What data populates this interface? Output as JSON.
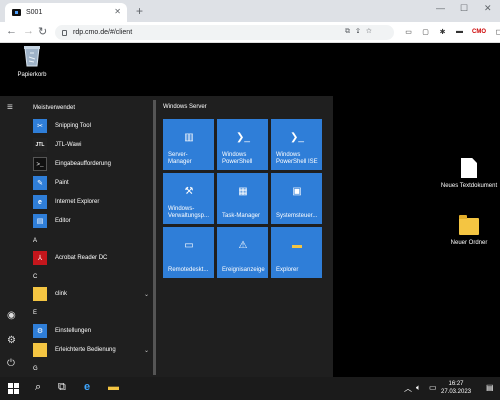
{
  "browser": {
    "tab_title": "S001",
    "tab_close": "✕",
    "new_tab": "+",
    "url": "rdp.cmo.de/#/client",
    "cmo_badge": "CMO",
    "back": "←",
    "forward": "→",
    "reload": "↻",
    "minimize": "—",
    "maximize": "☐",
    "close": "✕",
    "menu": "⋮"
  },
  "desktop": {
    "icons": [
      {
        "label": "Papierkorb",
        "icon": "recycle-bin-icon"
      },
      {
        "label": "Neues Textdokument",
        "icon": "text-document-icon"
      },
      {
        "label": "Neuer Ordner",
        "icon": "folder-icon"
      }
    ]
  },
  "start_menu": {
    "list_header": "Meistverwendet",
    "most_used": [
      {
        "label": "Snipping Tool",
        "icon": "snipping-tool-icon",
        "color": "#2f7ed8"
      },
      {
        "label": "JTL-Wawi",
        "icon": "jtl-icon",
        "color": "#222222"
      },
      {
        "label": "Eingabeaufforderung",
        "icon": "command-prompt-icon",
        "color": "#111111"
      },
      {
        "label": "Paint",
        "icon": "paint-icon",
        "color": "#2f7ed8"
      },
      {
        "label": "Internet Explorer",
        "icon": "internet-explorer-icon",
        "color": "#2f7ed8"
      },
      {
        "label": "Editor",
        "icon": "notepad-icon",
        "color": "#2f7ed8"
      }
    ],
    "groups": [
      {
        "letter": "A",
        "items": [
          {
            "label": "Acrobat Reader DC",
            "icon": "acrobat-icon",
            "color": "#c4161c",
            "expand": false
          }
        ]
      },
      {
        "letter": "C",
        "items": [
          {
            "label": "clink",
            "icon": "folder-icon",
            "color": "#f4c542",
            "expand": true
          }
        ]
      },
      {
        "letter": "E",
        "items": [
          {
            "label": "Einstellungen",
            "icon": "settings-icon",
            "color": "#2f7ed8",
            "expand": false
          },
          {
            "label": "Erleichterte Bedienung",
            "icon": "folder-icon",
            "color": "#f4c542",
            "expand": true
          }
        ]
      },
      {
        "letter": "G",
        "items": []
      }
    ],
    "tiles_title": "Windows Server",
    "tiles": [
      {
        "label": "Server-\nManager",
        "icon": "server-manager-icon"
      },
      {
        "label": "Windows\nPowerShell",
        "icon": "powershell-icon"
      },
      {
        "label": "Windows\nPowerShell ISE",
        "icon": "powershell-ise-icon"
      },
      {
        "label": "Windows-\nVerwaltungsp...",
        "icon": "admin-tools-icon"
      },
      {
        "label": "Task-Manager",
        "icon": "task-manager-icon"
      },
      {
        "label": "Systemsteuer...",
        "icon": "control-panel-icon"
      },
      {
        "label": "Remotedeskt...",
        "icon": "remote-desktop-icon"
      },
      {
        "label": "Ereignisanzeige",
        "icon": "event-viewer-icon"
      },
      {
        "label": "Explorer",
        "icon": "file-explorer-icon"
      }
    ]
  },
  "taskbar": {
    "time": "16:27",
    "date": "27.03.2023"
  }
}
